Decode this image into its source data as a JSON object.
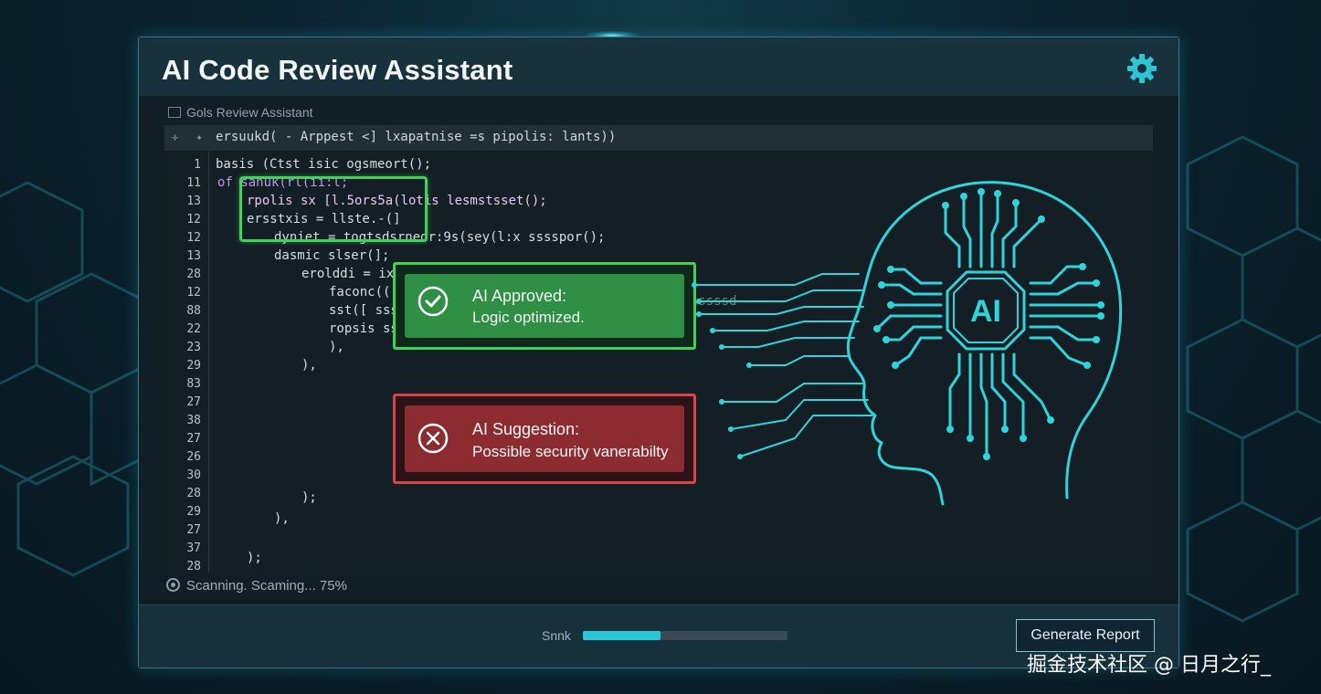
{
  "window": {
    "title": "AI Code Review Assistant",
    "settings_icon": "gear-icon"
  },
  "panel": {
    "subtitle": "Gols Review Assistant",
    "toolbar_text": "ersuukd( - Arppest <] lxapatnise =s pipolis: lants))"
  },
  "code": {
    "line_numbers": [
      "1",
      "11",
      "13",
      "12",
      "12",
      "13",
      "28",
      "12",
      "88",
      "22",
      "23",
      "29",
      "83",
      "27",
      "38",
      "27",
      "26",
      "30",
      "28",
      "29",
      "27",
      "37",
      "28"
    ],
    "lines": [
      "basis (Ctst isic ogsmeort();",
      "of sanuk(rl(ii:l;",
      "rpolis sx [l.5ors5a(lotis lesmstsset();",
      "ersstxis  = llste.-(]",
      "dyniet  =  togtsdsrnedr:9s(sey(l:x  sssspor();",
      "dasmic  slser(];",
      "erolddi  =  ixntma(lxsgs:sg:s:+:s:s);",
      "faconc((",
      "sst([ ssss",
      "ropsis  ss(",
      "),",
      "),",
      ");",
      "),",
      ");"
    ],
    "comment": "// rostrssssssd"
  },
  "approved": {
    "title": "AI Approved:",
    "message": "Logic optimized.",
    "icon": "check-circle-icon",
    "color": "#3fd35a"
  },
  "suggestion": {
    "title": "AI Suggestion:",
    "message": "Possible security vanerabilty",
    "icon": "x-circle-icon",
    "color": "#d8444c"
  },
  "brain": {
    "chip_label": "AI",
    "icon": "ai-brain-circuit-icon",
    "color": "#2fd3db"
  },
  "status": {
    "text": "Scanning. Scaming... 75%"
  },
  "footer": {
    "progress_label": "Snnk",
    "progress_fraction": 0.38,
    "generate_label": "Generate Report"
  },
  "watermark": "掘金技术社区 @ 日月之行_"
}
